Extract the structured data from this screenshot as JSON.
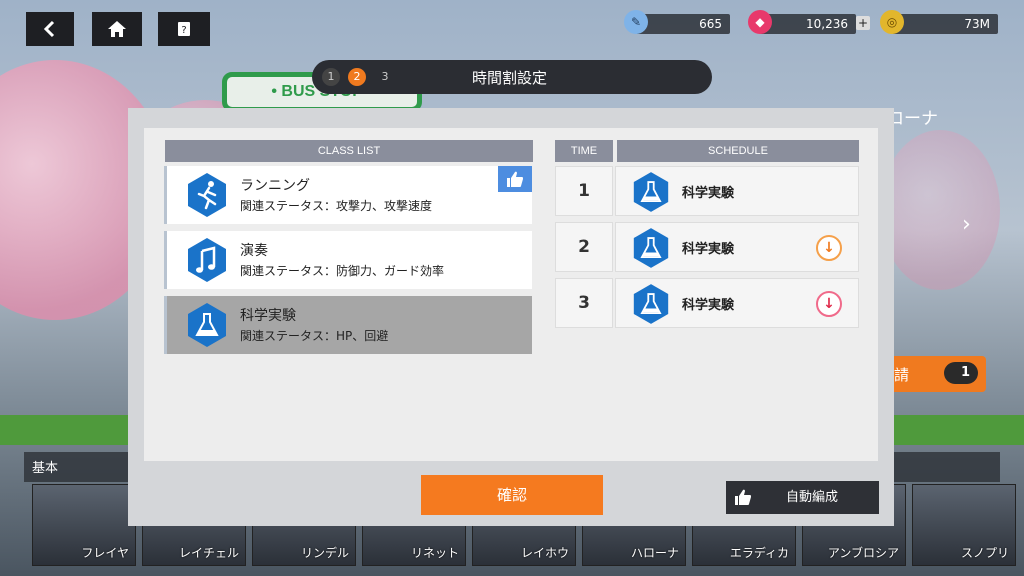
{
  "topbar": {
    "back_label": "back",
    "home_label": "home",
    "help_label": "help",
    "tickets": "665",
    "gems": "10,236",
    "gold": "73M",
    "plus": "+"
  },
  "steps": {
    "items": [
      "1",
      "2",
      "3"
    ],
    "active_index": 1,
    "title": "時間割設定"
  },
  "class_list": {
    "header": "CLASS LIST",
    "items": [
      {
        "name": "ランニング",
        "stats": "関連ステータス：攻撃力、攻撃速度",
        "icon": "running-icon",
        "recommended": true
      },
      {
        "name": "演奏",
        "stats": "関連ステータス：防御力、ガード効率",
        "icon": "music-note-icon",
        "recommended": false
      },
      {
        "name": "科学実験",
        "stats": "関連ステータス：HP、回避",
        "icon": "flask-icon",
        "recommended": false,
        "selected": true
      }
    ]
  },
  "schedule": {
    "time_header": "TIME",
    "schedule_header": "SCHEDULE",
    "rows": [
      {
        "time": "1",
        "name": "科学実験",
        "icon": "flask-icon"
      },
      {
        "time": "2",
        "name": "科学実験",
        "icon": "flask-icon",
        "arrow": "orange"
      },
      {
        "time": "3",
        "name": "科学実験",
        "icon": "flask-icon",
        "arrow": "red"
      }
    ]
  },
  "buttons": {
    "confirm": "確認",
    "auto": "自動編成"
  },
  "background": {
    "bus_stop": "• BUS STOP •",
    "char_name": "ハローナ",
    "request_label": "請",
    "request_count": "1",
    "basic_label": "基本",
    "roster": [
      "フレイヤ",
      "レイチェル",
      "リンデル",
      "リネット",
      "レイホウ",
      "ハローナ",
      "エラディカ",
      "アンブロシア",
      "スノプリ"
    ]
  },
  "colors": {
    "accent": "#f57a1f",
    "hex_blue": "#1a73c9",
    "header_gray": "#8a8e9c"
  }
}
